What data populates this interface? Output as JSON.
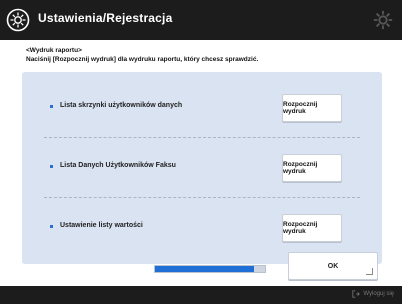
{
  "window": {
    "title": "Ustawienia/Rejestracja"
  },
  "instructions": {
    "heading": "<Wydruk raportu>",
    "body": "Naciśnij [Rozpocznij wydruk] dla wydruku raportu, który chcesz sprawdzić."
  },
  "rows": [
    {
      "label": "Lista skrzynki użytkowników danych",
      "button": "Rozpocznij wydruk"
    },
    {
      "label": "Lista Danych Użytkowników Faksu",
      "button": "Rozpocznij wydruk"
    },
    {
      "label": "Ustawienie listy wartości",
      "button": "Rozpocznij wydruk"
    }
  ],
  "progress": {
    "value": 0.9
  },
  "ok_button": {
    "label": "OK"
  },
  "footer": {
    "status": "Wyloguj się"
  },
  "colors": {
    "accent": "#1f6fd6",
    "panel": "#d9e3f1",
    "bar": "#1c1c1c"
  }
}
